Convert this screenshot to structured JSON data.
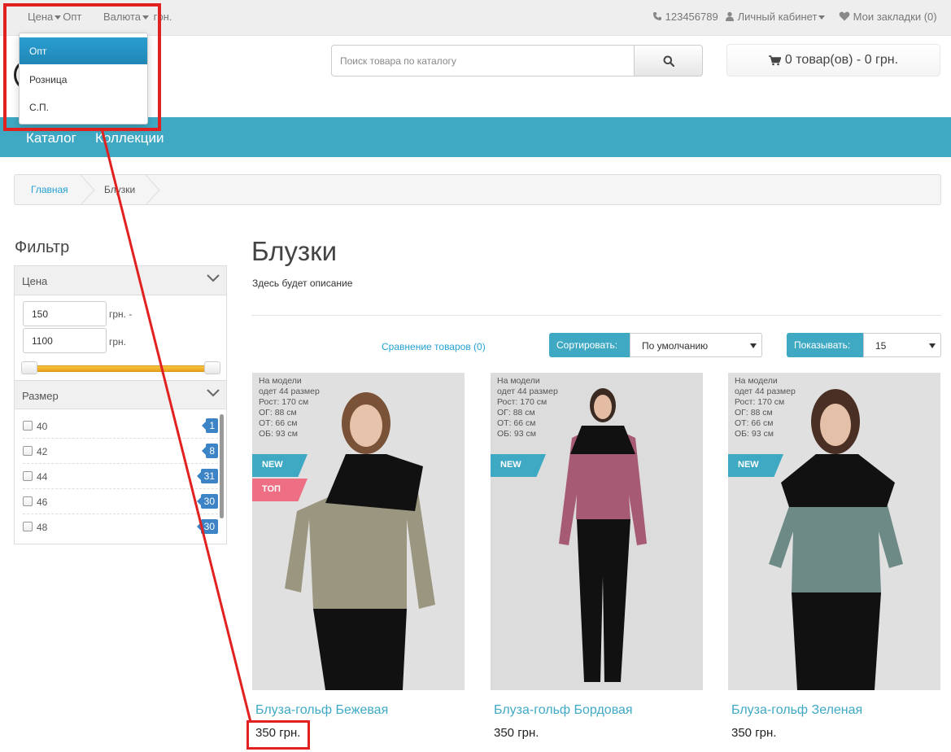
{
  "topbar": {
    "price_label": "Цена",
    "price_value": "Опт",
    "currency_label": "Валюта",
    "currency_value": "грн.",
    "phone": "123456789",
    "account": "Личный кабинет",
    "wishlist": "Мои закладки (0)"
  },
  "price_dropdown": {
    "options": [
      "Опт",
      "Розница",
      "С.П."
    ],
    "selected": "Опт"
  },
  "search": {
    "placeholder": "Поиск товара по каталогу"
  },
  "cart": {
    "label": "0 товар(ов) - 0 грн."
  },
  "nav": {
    "items": [
      "Каталог",
      "Коллекции"
    ]
  },
  "breadcrumb": {
    "items": [
      "Главная",
      "Блузки"
    ]
  },
  "filter": {
    "title": "Фильтр",
    "price": {
      "heading": "Цена",
      "min": "150",
      "max": "1100",
      "min_unit": "грн. -",
      "max_unit": "грн."
    },
    "size": {
      "heading": "Размер",
      "options": [
        {
          "label": "40",
          "count": "1"
        },
        {
          "label": "42",
          "count": "8"
        },
        {
          "label": "44",
          "count": "31"
        },
        {
          "label": "46",
          "count": "30"
        },
        {
          "label": "48",
          "count": "30"
        }
      ]
    }
  },
  "category": {
    "title": "Блузки",
    "description": "Здесь будет описание",
    "compare_link": "Сравнение товаров (0)",
    "sort_label": "Сортировать:",
    "sort_value": "По умолчанию",
    "show_label": "Показывать:",
    "show_value": "15"
  },
  "products": [
    {
      "name": "Блуза-гольф Бежевая",
      "price": "350 грн.",
      "model_info": [
        "На модели",
        "одет 44 размер",
        "Рост: 170 см",
        "ОГ: 88 см",
        "ОТ: 66 см",
        "ОБ: 93 см"
      ],
      "badges": [
        "NEW",
        "ТОП"
      ],
      "top_color": "#9a967f",
      "bg_color": "#e0e0e0"
    },
    {
      "name": "Блуза-гольф Бордовая",
      "price": "350 грн.",
      "model_info": [
        "На модели",
        "одет 44 размер",
        "Рост: 170 см",
        "ОГ: 88 см",
        "ОТ: 66 см",
        "ОБ: 93 см"
      ],
      "badges": [
        "NEW"
      ],
      "top_color": "#a75a73",
      "bg_color": "#dcdcdc"
    },
    {
      "name": "Блуза-гольф Зеленая",
      "price": "350 грн.",
      "model_info": [
        "На модели",
        "одет 44 размер",
        "Рост: 170 см",
        "ОГ: 88 см",
        "ОТ: 66 см",
        "ОБ: 93 см"
      ],
      "badges": [
        "NEW"
      ],
      "top_color": "#6d8a86",
      "bg_color": "#e0e0e0"
    }
  ],
  "colors": {
    "accent": "#3fa9c4",
    "highlight": "#e0211f",
    "link": "#23a1d1",
    "badge_blue": "#3d84c7",
    "badge_top": "#ee6e83"
  }
}
